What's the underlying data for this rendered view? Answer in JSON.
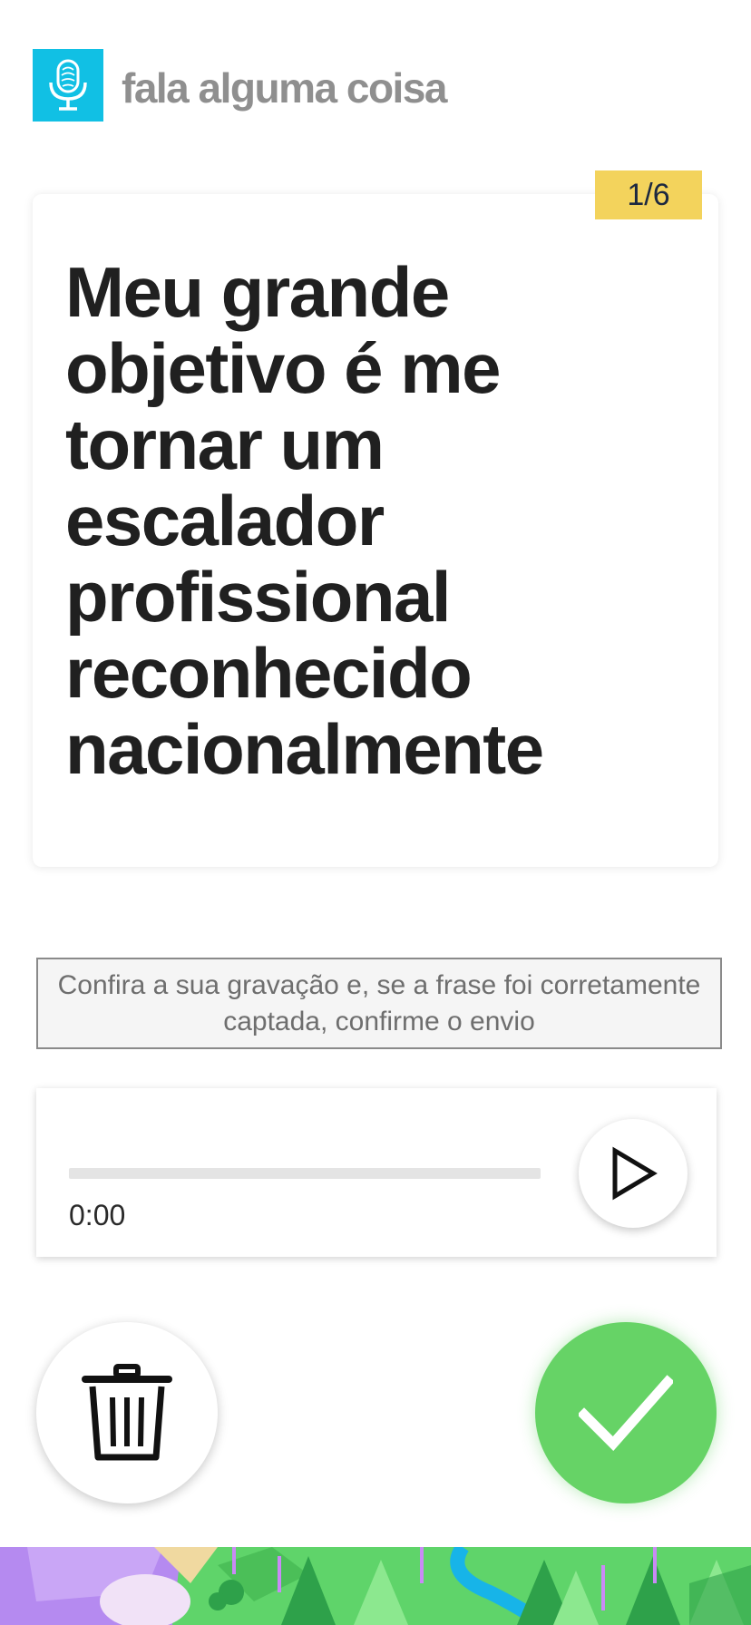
{
  "header": {
    "brand": "fala alguma coisa",
    "logo_icon": "microphone-fingerprint-icon",
    "logo_color": "#11c0e4"
  },
  "card": {
    "counter": "1/6",
    "counter_color": "#f3d35c",
    "sentence": "Meu grande objetivo é me tornar um escalador profissional reconhecido nacionalmente"
  },
  "instruction": {
    "text": "Confira a sua gravação e, se a frase foi corretamente captada, confirme o envio"
  },
  "player": {
    "time": "0:00",
    "progress": 0,
    "play_icon": "play-icon"
  },
  "actions": {
    "delete_icon": "trash-icon",
    "confirm_icon": "checkmark-icon",
    "confirm_color": "#66d366"
  }
}
